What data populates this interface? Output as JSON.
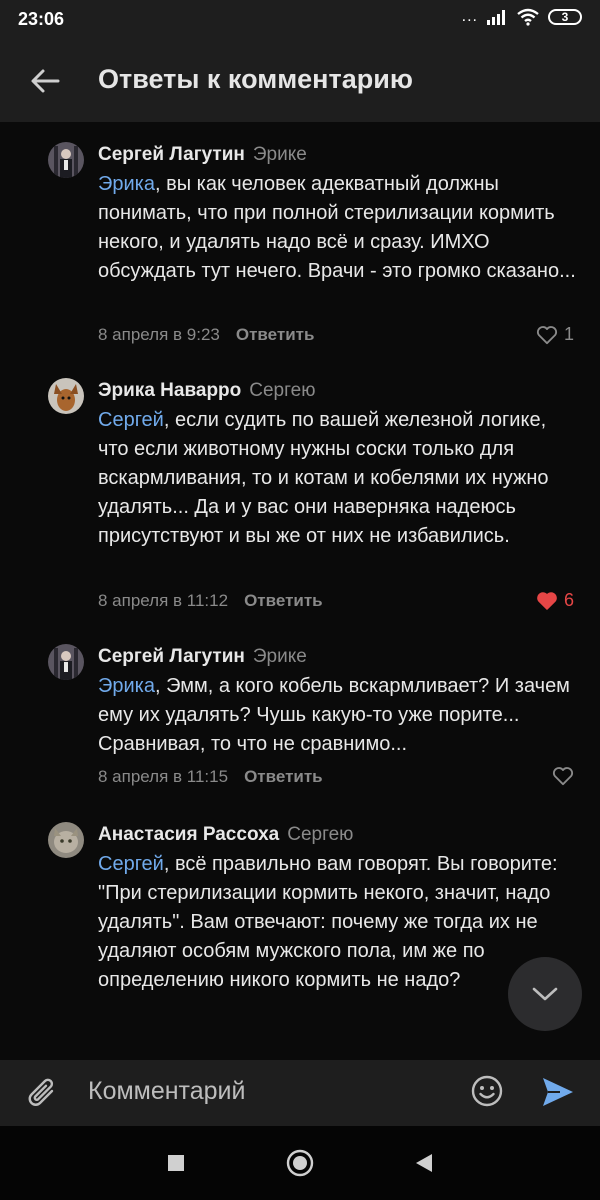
{
  "status": {
    "time": "23:06",
    "signal": "...",
    "battery": "3"
  },
  "header": {
    "title": "Ответы к комментарию"
  },
  "comments": [
    {
      "author": "Сергей Лагутин",
      "reply_to": "Эрике",
      "mention": "Эрика",
      "text": ", вы как человек адекватный должны понимать, что при полной стерилизации кормить некого, и удалять надо всё и сразу. ИМХО обсуждать тут нечего. Врачи - это громко сказано...",
      "date": "8 апреля в 9:23",
      "reply_label": "Ответить",
      "likes": "1",
      "liked": false
    },
    {
      "author": "Эрика Наварро",
      "reply_to": "Сергею",
      "mention": "Сергей",
      "text": ", если судить по вашей железной логике, что если животному нужны соски только для вскармливания, то и котам и кобелями их нужно удалять... Да и у вас они наверняка надеюсь присутствуют и вы же от них не избавились.",
      "date": "8 апреля в 11:12",
      "reply_label": "Ответить",
      "likes": "6",
      "liked": true
    },
    {
      "author": "Сергей Лагутин",
      "reply_to": "Эрике",
      "mention": "Эрика",
      "text": ", Эмм, а кого кобель вскармливает? И зачем ему их удалять? Чушь какую-то уже порите... Сравнивая, то что не сравнимо...",
      "date": "8 апреля в 11:15",
      "reply_label": "Ответить",
      "likes": "",
      "liked": false
    },
    {
      "author": "Анастасия Рассоха",
      "reply_to": "Сергею",
      "mention": "Сергей",
      "text": ", всё правильно вам говорят. Вы говорите: \"При стерилизации кормить некого, значит, надо удалять\". Вам отвечают: почему же тогда их не удаляют особям мужского пола, им же по определению никого кормить не надо?",
      "date": "",
      "reply_label": "",
      "likes": "",
      "liked": false
    }
  ],
  "composer": {
    "placeholder": "Комментарий"
  },
  "colors": {
    "accent": "#71aaeb",
    "liked": "#e64646",
    "background": "#0a0a0a",
    "bar": "#1e1e1e"
  }
}
